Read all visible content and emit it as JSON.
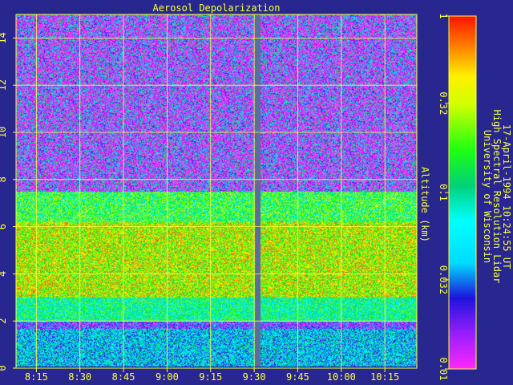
{
  "chart_data": {
    "type": "heatmap",
    "title": "Aerosol Depolarization",
    "ylabel": "Altitude (km)",
    "x_ticks": [
      "8:15",
      "8:30",
      "8:45",
      "9:00",
      "9:15",
      "9:30",
      "9:45",
      "10:00",
      "10:15"
    ],
    "xlim": [
      "8:08",
      "10:26"
    ],
    "y_ticks": [
      "0",
      "2",
      "4",
      "6",
      "8",
      "10",
      "12",
      "14"
    ],
    "ylim": [
      0,
      15
    ],
    "colorbar": {
      "scale": "log",
      "range": [
        0.01,
        1
      ],
      "tick_labels": [
        "0.01",
        "0.032",
        "0.1",
        "0.32",
        "1"
      ]
    },
    "dropout_time": "9:31",
    "layers": [
      {
        "bottom_km": 0.1,
        "top_km": 1.7,
        "depolarization": 0.05
      },
      {
        "bottom_km": 1.7,
        "top_km": 2.0,
        "depolarization": 0.02
      },
      {
        "bottom_km": 2.0,
        "top_km": 3.0,
        "depolarization": 0.1
      },
      {
        "bottom_km": 3.0,
        "top_km": 6.2,
        "depolarization": 0.3
      },
      {
        "bottom_km": 6.2,
        "top_km": 7.5,
        "depolarization": 0.15
      },
      {
        "bottom_km": 7.5,
        "top_km": 15.0,
        "depolarization": 0.02
      }
    ],
    "grid": true
  },
  "credits": {
    "line1": "University of Wisconsin",
    "line2": "High Spectral Resolution Lidar",
    "line3": "17-April-1994 10:24:55 UT"
  },
  "colors": {
    "background": "#27278f",
    "axes": "#ffff40",
    "text": "#ffff40",
    "dropout": "#5a6e9c"
  }
}
